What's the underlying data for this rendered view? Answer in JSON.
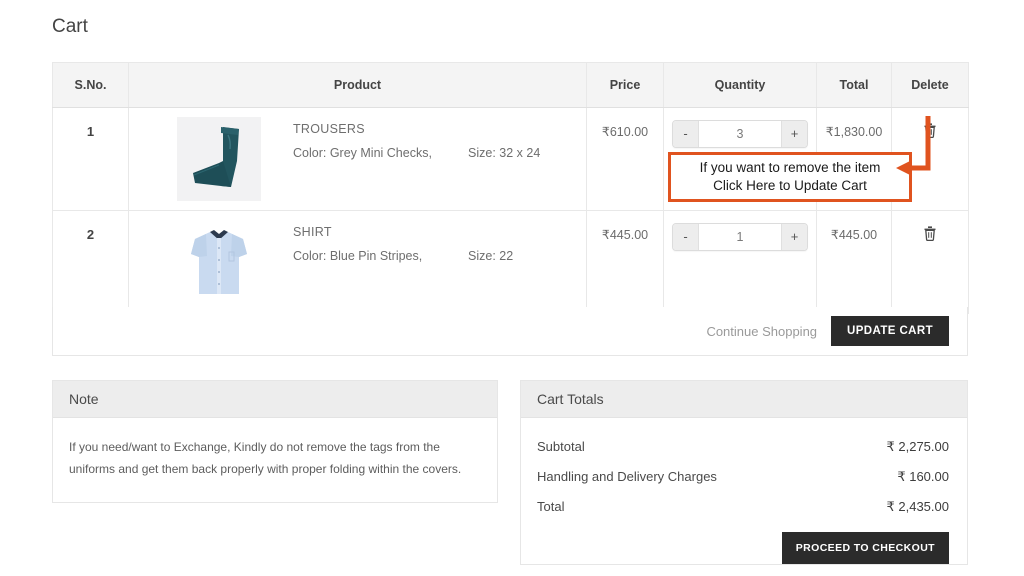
{
  "page": {
    "title": "Cart"
  },
  "table": {
    "headers": [
      "S.No.",
      "Product",
      "Price",
      "Quantity",
      "Total",
      "Delete"
    ],
    "rows": [
      {
        "sno": "1",
        "name": "TROUSERS",
        "color": "Color: Grey Mini Checks,",
        "size": "Size: 32 x 24",
        "price": "₹610.00",
        "qty": "3",
        "total": "₹1,830.00",
        "minus_label": "-",
        "plus_label": "+",
        "thumb": "trousers-thumbnail"
      },
      {
        "sno": "2",
        "name": "SHIRT",
        "color": "Color: Blue Pin Stripes,",
        "size": "Size: 22",
        "price": "₹445.00",
        "qty": "1",
        "total": "₹445.00",
        "minus_label": "-",
        "plus_label": "+",
        "thumb": "shirt-thumbnail"
      }
    ],
    "footer": {
      "continue_label": "Continue Shopping",
      "update_label": "UPDATE CART"
    }
  },
  "annotation": {
    "line1": "If you want to remove the item",
    "line2": "Click Here to Update Cart",
    "color": "#e0531f"
  },
  "note": {
    "heading": "Note",
    "body": "If you need/want to Exchange, Kindly do not remove the tags from the uniforms and get them back properly with proper folding within the covers."
  },
  "totals": {
    "heading": "Cart Totals",
    "lines": [
      {
        "label": "Subtotal",
        "amount": "₹ 2,275.00"
      },
      {
        "label": "Handling and Delivery Charges",
        "amount": "₹ 160.00"
      },
      {
        "label": "Total",
        "amount": "₹ 2,435.00"
      }
    ],
    "checkout_label": "PROCEED TO CHECKOUT"
  }
}
